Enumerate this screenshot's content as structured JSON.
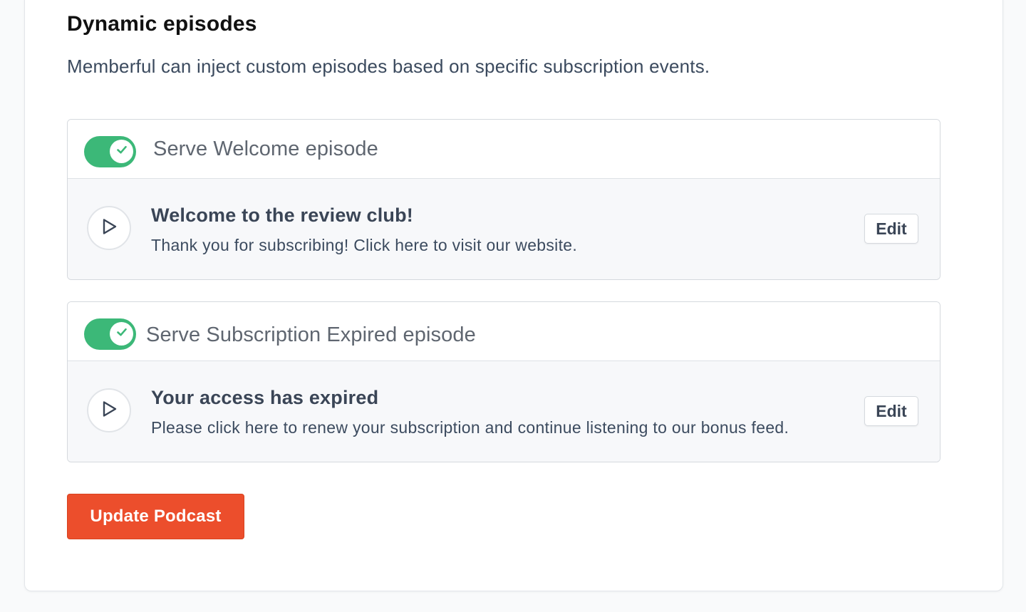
{
  "section": {
    "title": "Dynamic episodes",
    "description": "Memberful can inject custom episodes based on specific subscription events."
  },
  "episodes": [
    {
      "toggle_label": "Serve Welcome episode",
      "toggle_on": true,
      "title": "Welcome to the review club!",
      "description": "Thank you for subscribing! Click here to visit our website.",
      "edit_label": "Edit"
    },
    {
      "toggle_label": "Serve Subscription Expired episode",
      "toggle_on": true,
      "title": "Your access has expired",
      "description": "Please click here to renew your subscription and continue listening to our bonus feed.",
      "edit_label": "Edit"
    }
  ],
  "actions": {
    "update_label": "Update Podcast"
  },
  "colors": {
    "accent": "#ec4e2c",
    "toggle_on": "#3cb878"
  },
  "icons": {
    "toggle_knob": "check-icon",
    "episode_play": "play-icon"
  }
}
